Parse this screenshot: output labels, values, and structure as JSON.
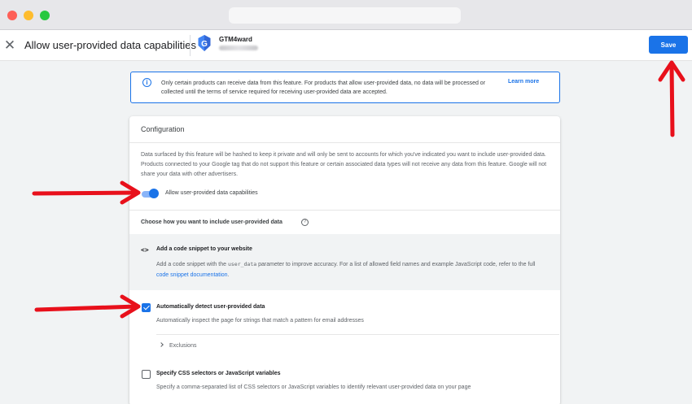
{
  "window": {
    "url": ""
  },
  "header": {
    "title": "Allow user-provided data capabilities",
    "account_name": "GTM4ward",
    "save_label": "Save"
  },
  "banner": {
    "text": "Only certain products can receive data from this feature. For products that allow user-provided data, no data will be processed or collected until the terms of service required for receiving user-provided data are accepted.",
    "learn_more": "Learn more"
  },
  "config": {
    "title": "Configuration",
    "description": "Data surfaced by this feature will be hashed to keep it private and will only be sent to accounts for which you've indicated you want to include user-provided data. Products connected to your Google tag that do not support this feature or certain associated data types will not receive any data from this feature. Google will not share your data with other advertisers.",
    "toggle_label": "Allow user-provided data capabilities",
    "toggle_on": true,
    "choose_label": "Choose how you want to include user-provided data",
    "snippet": {
      "title": "Add a code snippet to your website",
      "desc_part1": "Add a code snippet with the ",
      "param": "user_data",
      "desc_part2": " parameter to improve accuracy. For a list of allowed field names and example JavaScript code, refer to the full ",
      "link": "code snippet documentation",
      "desc_part3": "."
    },
    "auto_detect": {
      "title": "Automatically detect user-provided data",
      "desc": "Automatically inspect the page for strings that match a pattern for email addresses",
      "checked": true,
      "exclusions_label": "Exclusions"
    },
    "css_selectors": {
      "title": "Specify CSS selectors or JavaScript variables",
      "desc": "Specify a comma-separated list of CSS selectors or JavaScript variables to identify relevant user-provided data on your page",
      "checked": false
    }
  },
  "colors": {
    "accent": "#1a73e8",
    "annotation_arrow": "#e8101b"
  }
}
